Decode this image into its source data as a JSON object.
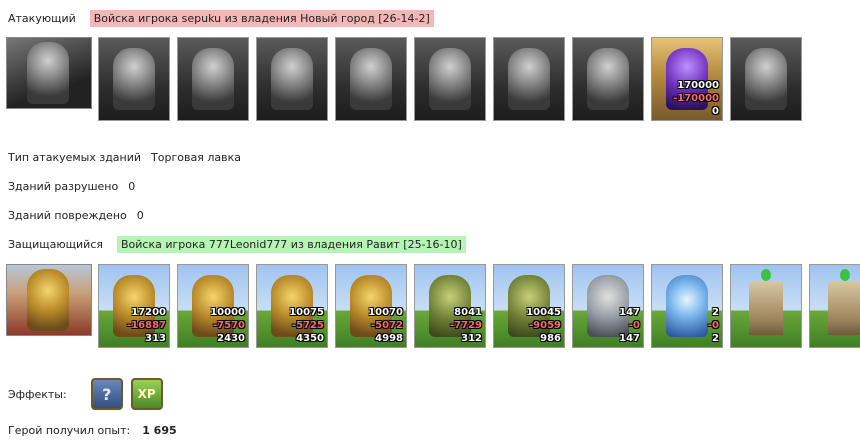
{
  "attacker": {
    "label": "Атакующий",
    "troops_title": "Войска игрока sepuku из владения Новый город [26-14-2]",
    "units": [
      {
        "name": "hero-attacker",
        "style": "heroA",
        "fig": "fig-gray",
        "nums": []
      },
      {
        "name": "unit-1",
        "style": "gray",
        "fig": "fig-gray",
        "nums": []
      },
      {
        "name": "unit-2",
        "style": "gray",
        "fig": "fig-gray",
        "nums": []
      },
      {
        "name": "unit-3",
        "style": "gray",
        "fig": "fig-gray",
        "nums": []
      },
      {
        "name": "unit-4",
        "style": "gray",
        "fig": "fig-gray",
        "nums": []
      },
      {
        "name": "unit-5",
        "style": "gray",
        "fig": "fig-gray",
        "nums": []
      },
      {
        "name": "unit-6",
        "style": "gray",
        "fig": "fig-gray",
        "nums": []
      },
      {
        "name": "unit-7",
        "style": "gray",
        "fig": "fig-gray",
        "nums": []
      },
      {
        "name": "unit-8",
        "style": "purple",
        "fig": "fig-purple",
        "nums": [
          "170000",
          "-170000",
          "0"
        ]
      },
      {
        "name": "unit-9",
        "style": "gray",
        "fig": "fig-gray",
        "nums": []
      }
    ]
  },
  "building_type": {
    "label": "Тип атакуемых зданий",
    "value": "Торговая лавка"
  },
  "destroyed": {
    "label": "Зданий разрушено",
    "value": "0"
  },
  "damaged": {
    "label": "Зданий повреждено",
    "value": "0"
  },
  "defender": {
    "label": "Защищающийся",
    "troops_title": "Войска игрока 777Leonid777 из владения Равит [25-16-10]",
    "units": [
      {
        "name": "hero-defender",
        "style": "heroD",
        "fig": "fig-gold",
        "nums": []
      },
      {
        "name": "unit-1",
        "style": "sky",
        "fig": "fig-gold",
        "nums": [
          "17200",
          "-16887",
          "313"
        ]
      },
      {
        "name": "unit-2",
        "style": "sky",
        "fig": "fig-gold",
        "nums": [
          "10000",
          "-7570",
          "2430"
        ]
      },
      {
        "name": "unit-3",
        "style": "sky",
        "fig": "fig-gold",
        "nums": [
          "10075",
          "-5725",
          "4350"
        ]
      },
      {
        "name": "unit-4",
        "style": "sky",
        "fig": "fig-gold",
        "nums": [
          "10070",
          "-5072",
          "4998"
        ]
      },
      {
        "name": "unit-5",
        "style": "sky",
        "fig": "fig-green",
        "nums": [
          "8041",
          "-7729",
          "312"
        ]
      },
      {
        "name": "unit-6",
        "style": "sky",
        "fig": "fig-green",
        "nums": [
          "10045",
          "-9059",
          "986"
        ]
      },
      {
        "name": "unit-7",
        "style": "sky",
        "fig": "fig-steel",
        "nums": [
          "147",
          "-0",
          "147"
        ]
      },
      {
        "name": "unit-8",
        "style": "sky",
        "fig": "fig-blue",
        "nums": [
          "2",
          "-0",
          "2"
        ]
      },
      {
        "name": "tower-1",
        "style": "sky",
        "fig": "tower",
        "nums": []
      },
      {
        "name": "tower-2",
        "style": "sky",
        "fig": "tower",
        "nums": []
      }
    ]
  },
  "effects": {
    "label": "Эффекты:",
    "icons": [
      "question-icon",
      "xp-icon"
    ],
    "q_glyph": "?",
    "xp_glyph": "XP"
  },
  "experience": {
    "label": "Герой получил опыт:",
    "value": "1 695"
  }
}
